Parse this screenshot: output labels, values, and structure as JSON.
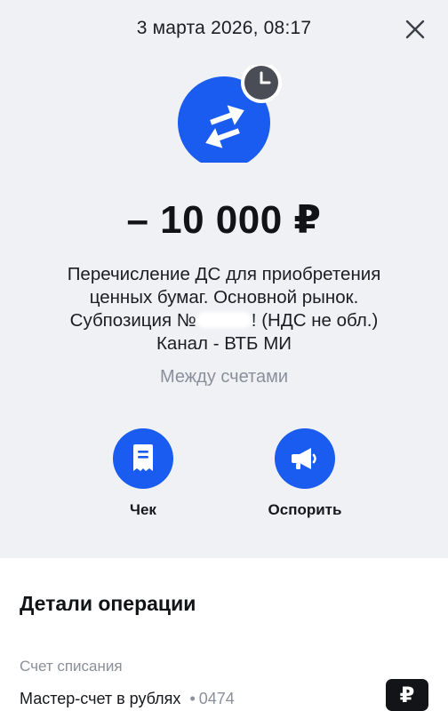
{
  "header": {
    "datetime": "3 марта 2026, 08:17"
  },
  "operation": {
    "icon": "transfer-arrows-icon",
    "status_icon": "clock-icon",
    "amount": "– 10 000 ₽",
    "description_line1": "Перечисление ДС для приобретения",
    "description_line2": "ценных бумаг. Основной рынок.",
    "description_line3_prefix": "Субпозиция №",
    "description_line3_suffix": "! (НДС не обл.)",
    "description_line4": "Канал - ВТБ МИ",
    "category": "Между счетами"
  },
  "actions": {
    "receipt_label": "Чек",
    "dispute_label": "Оспорить"
  },
  "details": {
    "title": "Детали операции",
    "debit_account_label": "Счет списания",
    "debit_account_name": "Мастер-счет в рублях",
    "debit_account_number": "0474",
    "currency_symbol": "₽"
  },
  "colors": {
    "accent": "#1a5cf0",
    "background_top": "#f0f1f5",
    "muted_text": "#8b8f9a"
  }
}
